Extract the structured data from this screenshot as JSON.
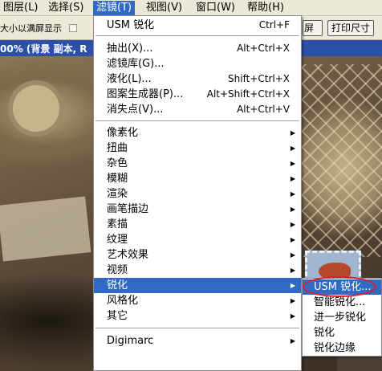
{
  "menubar": {
    "items": [
      "图层(L)",
      "选择(S)",
      "滤镜(T)",
      "视图(V)",
      "窗口(W)",
      "帮助(H)"
    ]
  },
  "options_bar": {
    "fit_text": "大小以满屏显示",
    "screen_button": "屏幕",
    "print_button": "打印尺寸"
  },
  "document": {
    "title": "00% (背景 副本, R"
  },
  "filter_menu": {
    "items": [
      {
        "label": "USM 锐化",
        "shortcut": "Ctrl+F"
      },
      {
        "label": "抽出(X)...",
        "shortcut": "Alt+Ctrl+X"
      },
      {
        "label": "滤镜库(G)...",
        "shortcut": ""
      },
      {
        "label": "液化(L)...",
        "shortcut": "Shift+Ctrl+X"
      },
      {
        "label": "图案生成器(P)...",
        "shortcut": "Alt+Shift+Ctrl+X"
      },
      {
        "label": "消失点(V)...",
        "shortcut": "Alt+Ctrl+V"
      },
      {
        "label": "像素化"
      },
      {
        "label": "扭曲"
      },
      {
        "label": "杂色"
      },
      {
        "label": "模糊"
      },
      {
        "label": "渲染"
      },
      {
        "label": "画笔描边"
      },
      {
        "label": "素描"
      },
      {
        "label": "纹理"
      },
      {
        "label": "艺术效果"
      },
      {
        "label": "视频"
      },
      {
        "label": "锐化"
      },
      {
        "label": "风格化"
      },
      {
        "label": "其它"
      },
      {
        "label": "Digimarc"
      }
    ]
  },
  "sharpen_submenu": {
    "items": [
      "USM 锐化...",
      "智能锐化...",
      "进一步锐化",
      "锐化",
      "锐化边缘"
    ]
  },
  "colors": {
    "highlight": "#316ac5",
    "menubar_bg": "#ece9d8",
    "annotation_circle": "#d8202a"
  },
  "icons": [
    "submenu-arrow-icon",
    "checkbox-icon"
  ]
}
